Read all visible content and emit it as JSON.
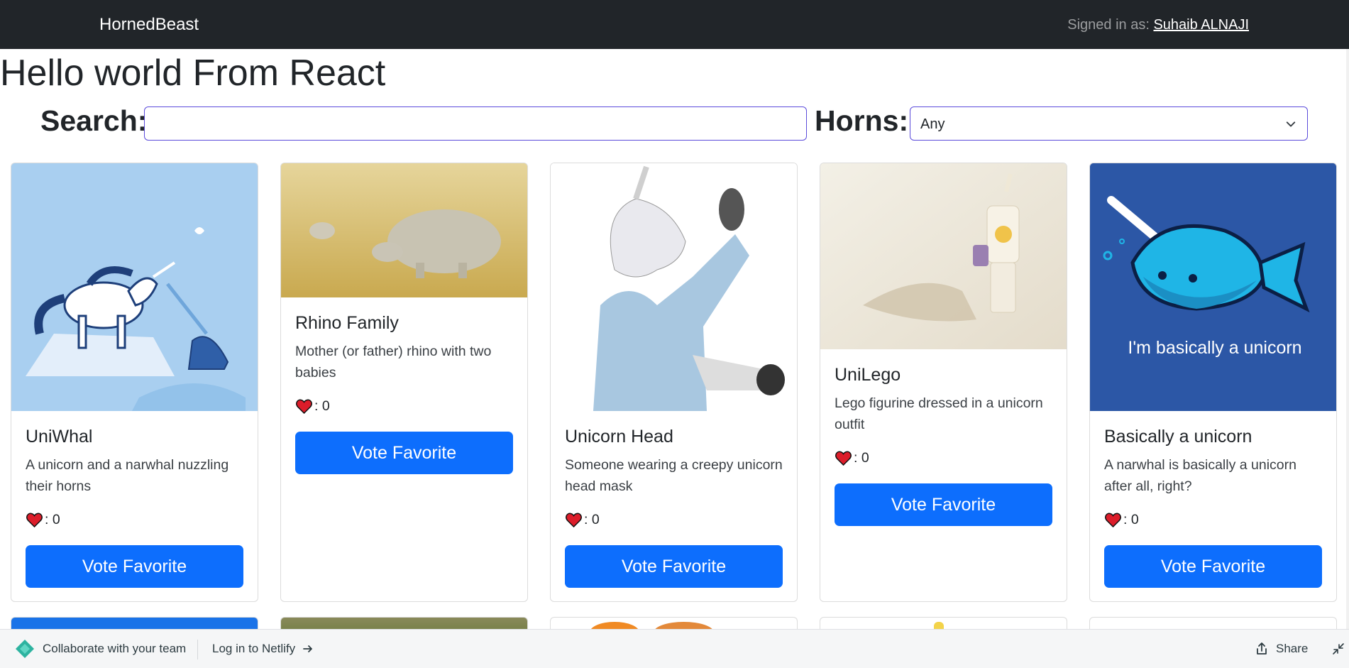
{
  "navbar": {
    "brand": "HornedBeast",
    "signed_in_prefix": "Signed in as:",
    "user_name": "Suhaib ALNAJI"
  },
  "page": {
    "title": "Hello world From React"
  },
  "filters": {
    "search_label": "Search:",
    "search_value": "",
    "horns_label": "Horns:",
    "horns_selected": "Any"
  },
  "cards": [
    {
      "title": "UniWhal",
      "description": "A unicorn and a narwhal nuzzling their horns",
      "votes_text": ": 0",
      "votes": 0,
      "button": "Vote Favorite"
    },
    {
      "title": "Rhino Family",
      "description": "Mother (or father) rhino with two babies",
      "votes_text": ": 0",
      "votes": 0,
      "button": "Vote Favorite"
    },
    {
      "title": "Unicorn Head",
      "description": "Someone wearing a creepy unicorn head mask",
      "votes_text": ": 0",
      "votes": 0,
      "button": "Vote Favorite"
    },
    {
      "title": "UniLego",
      "description": "Lego figurine dressed in a unicorn outfit",
      "votes_text": ": 0",
      "votes": 0,
      "button": "Vote Favorite"
    },
    {
      "title": "Basically a unicorn",
      "description": "A narwhal is basically a unicorn after all, right?",
      "votes_text": ": 0",
      "votes": 0,
      "button": "Vote Favorite",
      "image_text": "I'm basically a unicorn"
    }
  ],
  "netlify": {
    "collaborate": "Collaborate with your team",
    "login": "Log in to Netlify",
    "share": "Share"
  },
  "colors": {
    "navbar_bg": "#212529",
    "primary_button": "#0d6efd",
    "heart": "#dc1d2a",
    "input_border": "#5b4bdb"
  },
  "icons": [
    "heart-icon",
    "chevron-down-icon",
    "netlify-logo-icon",
    "arrow-right-icon",
    "share-icon",
    "collapse-icon"
  ]
}
